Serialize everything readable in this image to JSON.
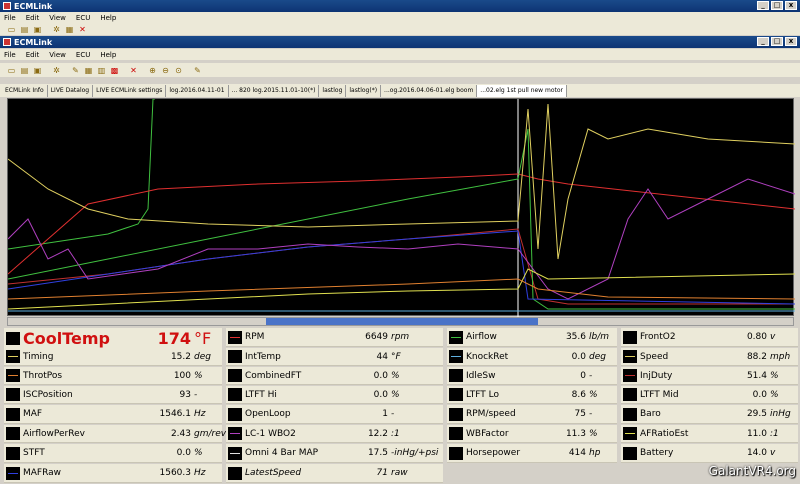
{
  "window_back": {
    "title": "ECMLink",
    "menus": [
      "File",
      "Edit",
      "View",
      "ECU",
      "Help"
    ]
  },
  "window_front": {
    "title": "ECMLink",
    "menus": [
      "File",
      "Edit",
      "View",
      "ECU",
      "Help"
    ]
  },
  "tabs": [
    "ECMLink Info",
    "LIVE Datalog",
    "LIVE ECMLink settings",
    "log.2016.04.11-01",
    "... 820 log.2015.11.01-10(*)",
    "lastlog",
    "lastlog(*)",
    "...og.2016.04.06-01.elg boom",
    "...02.elg 1st pull new motor"
  ],
  "active_tab": 8,
  "colors": {
    "graph_bg": "#000000",
    "value_red": "#d01010",
    "scroll_thumb": "#4a73c8"
  },
  "columns": [
    [
      {
        "name": "CoolTemp",
        "value": "174",
        "unit": "°F",
        "swatch": "#000000",
        "big": true
      },
      {
        "name": "Timing",
        "value": "15.2",
        "unit": "deg",
        "swatch": "#e0d060"
      },
      {
        "name": "ThrotPos",
        "value": "100",
        "unit": "%",
        "swatch": "#e08030"
      },
      {
        "name": "ISCPosition",
        "value": "93",
        "unit": "-",
        "swatch": "#000000"
      },
      {
        "name": "MAF",
        "value": "1546.1",
        "unit": "Hz",
        "swatch": "#000000"
      },
      {
        "name": "AirflowPerRev",
        "value": "2.43",
        "unit": "gm/rev",
        "swatch": "#000000"
      },
      {
        "name": "STFT",
        "value": "0.0",
        "unit": "%",
        "swatch": "#000000"
      },
      {
        "name": "MAFRaw",
        "value": "1560.3",
        "unit": "Hz",
        "swatch": "#3040e0"
      }
    ],
    [
      {
        "name": "RPM",
        "value": "6649",
        "unit": "rpm",
        "swatch": "#e03030"
      },
      {
        "name": "IntTemp",
        "value": "44",
        "unit": "°F",
        "swatch": "#000000"
      },
      {
        "name": "CombinedFT",
        "value": "0.0",
        "unit": "%",
        "swatch": "#000000"
      },
      {
        "name": "LTFT Hi",
        "value": "0.0",
        "unit": "%",
        "swatch": "#000000"
      },
      {
        "name": "OpenLoop",
        "value": "1",
        "unit": "-",
        "swatch": "#000000"
      },
      {
        "name": "LC-1 WBO2",
        "value": "12.2",
        "unit": ":1",
        "swatch": "#b040c0"
      },
      {
        "name": "Omni 4 Bar MAP",
        "value": "17.5",
        "unit": "-inHg/+psi",
        "swatch": "#e0e0e0"
      },
      {
        "name": "LatestSpeed",
        "value": "71",
        "unit": "raw",
        "swatch": "#000000",
        "italic": true
      }
    ],
    [
      {
        "name": "Airflow",
        "value": "35.6",
        "unit": "lb/m",
        "swatch": "#40c040"
      },
      {
        "name": "KnockRet",
        "value": "0.0",
        "unit": "deg",
        "swatch": "#60b0e0"
      },
      {
        "name": "IdleSw",
        "value": "0",
        "unit": "-",
        "swatch": "#000000"
      },
      {
        "name": "LTFT Lo",
        "value": "8.6",
        "unit": "%",
        "swatch": "#000000"
      },
      {
        "name": "RPM/speed",
        "value": "75",
        "unit": "-",
        "swatch": "#000000"
      },
      {
        "name": "WBFactor",
        "value": "11.3",
        "unit": "%",
        "swatch": "#000000"
      },
      {
        "name": "Horsepower",
        "value": "414",
        "unit": "hp",
        "swatch": "#000000"
      }
    ],
    [
      {
        "name": "FrontO2",
        "value": "0.80",
        "unit": "v",
        "swatch": "#000000"
      },
      {
        "name": "Speed",
        "value": "88.2",
        "unit": "mph",
        "swatch": "#e0d060"
      },
      {
        "name": "InjDuty",
        "value": "51.4",
        "unit": "%",
        "swatch": "#c03030"
      },
      {
        "name": "LTFT Mid",
        "value": "0.0",
        "unit": "%",
        "swatch": "#000000"
      },
      {
        "name": "Baro",
        "value": "29.5",
        "unit": "inHg",
        "swatch": "#000000"
      },
      {
        "name": "AFRatioEst",
        "value": "11.0",
        "unit": ":1",
        "swatch": "#e0e050"
      },
      {
        "name": "Battery",
        "value": "14.0",
        "unit": "v",
        "swatch": "#000000"
      }
    ]
  ],
  "watermark": "GalantVR4.org"
}
